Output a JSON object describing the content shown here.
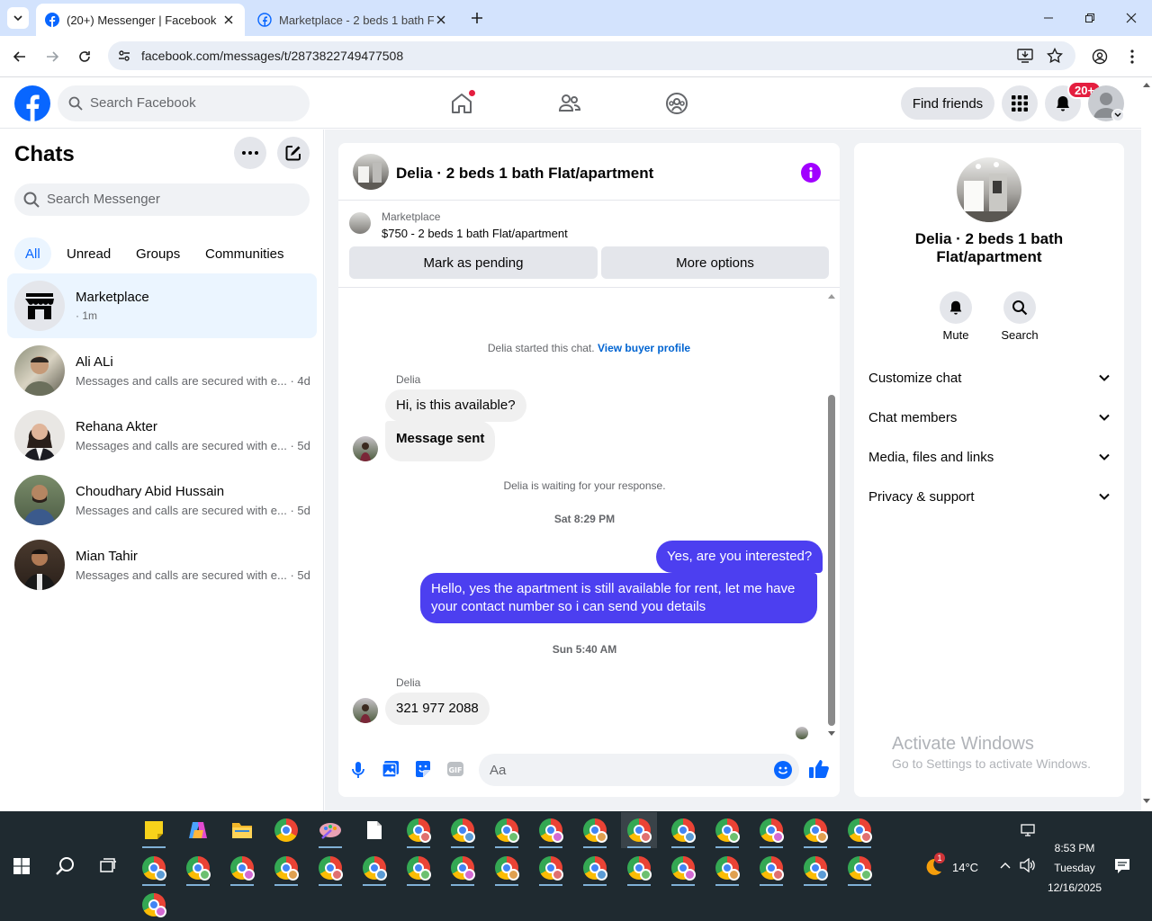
{
  "browser": {
    "tabs": [
      {
        "title": "(20+) Messenger | Facebook",
        "active": true
      },
      {
        "title": "Marketplace - 2 beds 1 bath Fla",
        "active": false
      }
    ],
    "url": "facebook.com/messages/t/2873822749477508"
  },
  "fb": {
    "search_placeholder": "Search Facebook",
    "find_friends": "Find friends",
    "notif_badge": "20+"
  },
  "sidebar": {
    "title": "Chats",
    "search_placeholder": "Search Messenger",
    "filters": [
      "All",
      "Unread",
      "Groups",
      "Communities"
    ],
    "chats": [
      {
        "name": "Marketplace",
        "preview": "· 1m"
      },
      {
        "name": "Ali ALi",
        "preview": "Messages and calls are secured with e... · 4d"
      },
      {
        "name": "Rehana Akter",
        "preview": "Messages and calls are secured with e... · 5d"
      },
      {
        "name": "Choudhary Abid Hussain",
        "preview": "Messages and calls are secured with e... · 5d"
      },
      {
        "name": "Mian Tahir",
        "preview": "Messages and calls are secured with e... · 5d"
      }
    ]
  },
  "conversation": {
    "title": "Delia · 2 beds 1 bath Flat/apartment",
    "listing_source": "Marketplace",
    "listing": "$750 - 2 beds 1 bath Flat/apartment",
    "btn_pending": "Mark as pending",
    "btn_more": "More options",
    "started_text": "Delia started this chat.",
    "view_profile": "View buyer profile",
    "sender": "Delia",
    "msg1": "Hi, is this available?",
    "msg2": "Message sent",
    "waiting": "Delia is waiting for your response.",
    "ts1": "Sat 8:29 PM",
    "out1": "Yes, are you interested?",
    "out2": "Hello, yes the apartment is still available for rent, let me have your contact number so i can send you details",
    "ts2": "Sun 5:40 AM",
    "msg3": "321 977 2088",
    "composer_placeholder": "Aa"
  },
  "info": {
    "title": "Delia · 2 beds 1 bath Flat/apartment",
    "mute": "Mute",
    "search": "Search",
    "sections": [
      "Customize chat",
      "Chat members",
      "Media, files and links",
      "Privacy & support"
    ]
  },
  "watermark": {
    "line1": "Activate Windows",
    "line2": "Go to Settings to activate Windows."
  },
  "taskbar": {
    "weather": "14°C",
    "weather_badge": "1",
    "time": "8:53 PM",
    "day": "Tuesday",
    "date": "12/16/2025"
  }
}
